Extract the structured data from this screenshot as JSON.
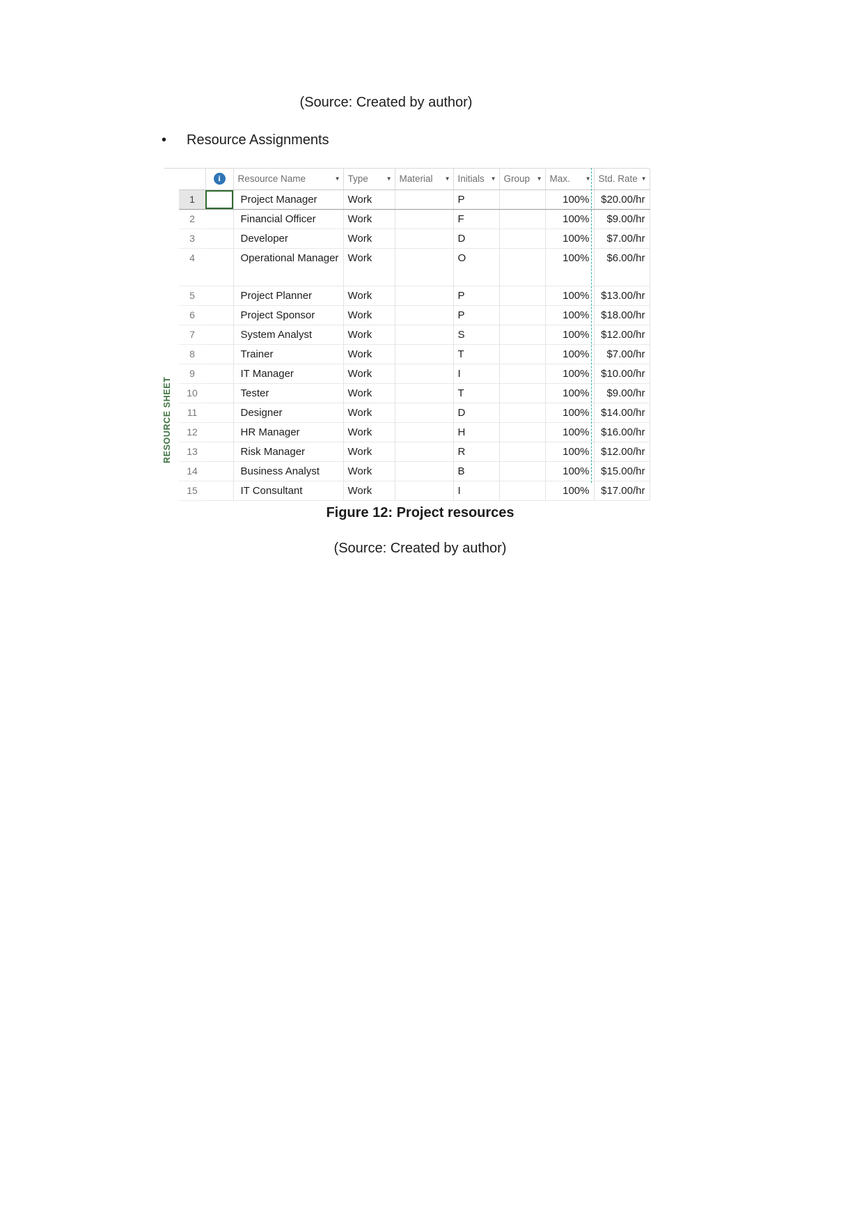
{
  "document": {
    "source_top": "(Source: Created by author)",
    "bullet_marker": "•",
    "bullet_text": "Resource Assignments",
    "figure_caption": "Figure 12: Project resources",
    "source_bottom": "(Source: Created by author)"
  },
  "sheet": {
    "tab_label": "RESOURCE SHEET",
    "info_icon": "i",
    "caret": "▼",
    "columns": [
      {
        "key": "name",
        "label": "Resource Name",
        "has_caret": true,
        "align": "left"
      },
      {
        "key": "type",
        "label": "Type",
        "has_caret": true,
        "align": "left"
      },
      {
        "key": "material",
        "label": "Material",
        "has_caret": true,
        "align": "left"
      },
      {
        "key": "initials",
        "label": "Initials",
        "has_caret": true,
        "align": "left"
      },
      {
        "key": "group",
        "label": "Group",
        "has_caret": true,
        "align": "left"
      },
      {
        "key": "max",
        "label": "Max.",
        "has_caret": true,
        "align": "left"
      },
      {
        "key": "rate",
        "label": "Std. Rate",
        "has_caret": true,
        "align": "left"
      }
    ],
    "rows": [
      {
        "n": "1",
        "name": "Project Manager",
        "type": "Work",
        "material": "",
        "initials": "P",
        "group": "",
        "max": "100%",
        "rate": "$20.00/hr",
        "selected": true,
        "tall": false
      },
      {
        "n": "2",
        "name": "Financial Officer",
        "type": "Work",
        "material": "",
        "initials": "F",
        "group": "",
        "max": "100%",
        "rate": "$9.00/hr",
        "selected": false,
        "tall": false
      },
      {
        "n": "3",
        "name": "Developer",
        "type": "Work",
        "material": "",
        "initials": "D",
        "group": "",
        "max": "100%",
        "rate": "$7.00/hr",
        "selected": false,
        "tall": false
      },
      {
        "n": "4",
        "name": "Operational Manager",
        "type": "Work",
        "material": "",
        "initials": "O",
        "group": "",
        "max": "100%",
        "rate": "$6.00/hr",
        "selected": false,
        "tall": true
      },
      {
        "n": "5",
        "name": "Project Planner",
        "type": "Work",
        "material": "",
        "initials": "P",
        "group": "",
        "max": "100%",
        "rate": "$13.00/hr",
        "selected": false,
        "tall": false
      },
      {
        "n": "6",
        "name": "Project Sponsor",
        "type": "Work",
        "material": "",
        "initials": "P",
        "group": "",
        "max": "100%",
        "rate": "$18.00/hr",
        "selected": false,
        "tall": false
      },
      {
        "n": "7",
        "name": "System Analyst",
        "type": "Work",
        "material": "",
        "initials": "S",
        "group": "",
        "max": "100%",
        "rate": "$12.00/hr",
        "selected": false,
        "tall": false
      },
      {
        "n": "8",
        "name": "Trainer",
        "type": "Work",
        "material": "",
        "initials": "T",
        "group": "",
        "max": "100%",
        "rate": "$7.00/hr",
        "selected": false,
        "tall": false
      },
      {
        "n": "9",
        "name": "IT Manager",
        "type": "Work",
        "material": "",
        "initials": "I",
        "group": "",
        "max": "100%",
        "rate": "$10.00/hr",
        "selected": false,
        "tall": false
      },
      {
        "n": "10",
        "name": "Tester",
        "type": "Work",
        "material": "",
        "initials": "T",
        "group": "",
        "max": "100%",
        "rate": "$9.00/hr",
        "selected": false,
        "tall": false
      },
      {
        "n": "11",
        "name": "Designer",
        "type": "Work",
        "material": "",
        "initials": "D",
        "group": "",
        "max": "100%",
        "rate": "$14.00/hr",
        "selected": false,
        "tall": false
      },
      {
        "n": "12",
        "name": "HR Manager",
        "type": "Work",
        "material": "",
        "initials": "H",
        "group": "",
        "max": "100%",
        "rate": "$16.00/hr",
        "selected": false,
        "tall": false
      },
      {
        "n": "13",
        "name": "Risk Manager",
        "type": "Work",
        "material": "",
        "initials": "R",
        "group": "",
        "max": "100%",
        "rate": "$12.00/hr",
        "selected": false,
        "tall": false
      },
      {
        "n": "14",
        "name": "Business Analyst",
        "type": "Work",
        "material": "",
        "initials": "B",
        "group": "",
        "max": "100%",
        "rate": "$15.00/hr",
        "selected": false,
        "tall": false
      },
      {
        "n": "15",
        "name": "IT Consultant",
        "type": "Work",
        "material": "",
        "initials": "I",
        "group": "",
        "max": "100%",
        "rate": "$17.00/hr",
        "selected": false,
        "tall": false
      }
    ]
  },
  "colors": {
    "tab_label": "#3f7341",
    "info_icon": "#2e75b6",
    "selection_border": "#2f6b2f",
    "page_break": "#2fb5a0"
  }
}
